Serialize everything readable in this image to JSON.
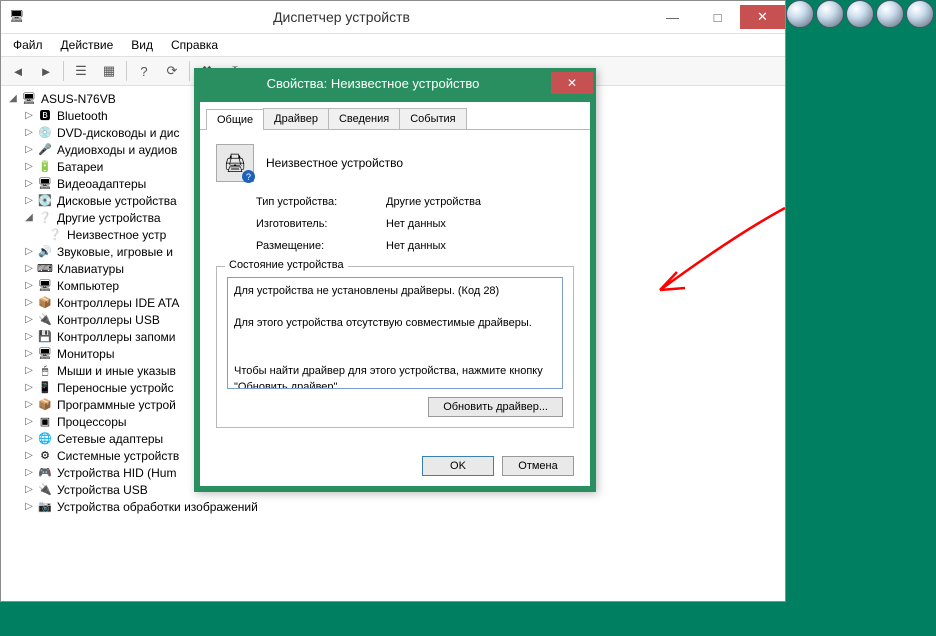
{
  "mainWindow": {
    "title": "Диспетчер устройств",
    "minimize": "—",
    "maximize": "□",
    "close": "✕"
  },
  "menu": {
    "file": "Файл",
    "action": "Действие",
    "view": "Вид",
    "help": "Справка"
  },
  "tree": {
    "root": "ASUS-N76VB",
    "items": [
      {
        "icon": "bt",
        "label": "Bluetooth",
        "exp": "▷"
      },
      {
        "icon": "dvd",
        "label": "DVD-дисководы и дис",
        "exp": "▷"
      },
      {
        "icon": "aud",
        "label": "Аудиовходы и аудиов",
        "exp": "▷"
      },
      {
        "icon": "bat",
        "label": "Батареи",
        "exp": "▷"
      },
      {
        "icon": "vid",
        "label": "Видеоадаптеры",
        "exp": "▷"
      },
      {
        "icon": "dsk",
        "label": "Дисковые устройства",
        "exp": "▷"
      },
      {
        "icon": "oth",
        "label": "Другие устройства",
        "exp": "◢",
        "child": "Неизвестное устр"
      },
      {
        "icon": "snd",
        "label": "Звуковые, игровые и",
        "exp": "▷"
      },
      {
        "icon": "kbd",
        "label": "Клавиатуры",
        "exp": "▷"
      },
      {
        "icon": "cmp",
        "label": "Компьютер",
        "exp": "▷"
      },
      {
        "icon": "ide",
        "label": "Контроллеры IDE ATA",
        "exp": "▷"
      },
      {
        "icon": "usb",
        "label": "Контроллеры USB",
        "exp": "▷"
      },
      {
        "icon": "stg",
        "label": "Контроллеры запоми",
        "exp": "▷"
      },
      {
        "icon": "mon",
        "label": "Мониторы",
        "exp": "▷"
      },
      {
        "icon": "mse",
        "label": "Мыши и иные указыв",
        "exp": "▷"
      },
      {
        "icon": "prt",
        "label": "Переносные устройс",
        "exp": "▷"
      },
      {
        "icon": "sft",
        "label": "Программные устрой",
        "exp": "▷"
      },
      {
        "icon": "cpu",
        "label": "Процессоры",
        "exp": "▷"
      },
      {
        "icon": "net",
        "label": "Сетевые адаптеры",
        "exp": "▷"
      },
      {
        "icon": "sys",
        "label": "Системные устройств",
        "exp": "▷"
      },
      {
        "icon": "hid",
        "label": "Устройства HID (Hum",
        "exp": "▷"
      },
      {
        "icon": "usb2",
        "label": "Устройства USB",
        "exp": "▷"
      },
      {
        "icon": "img",
        "label": "Устройства обработки изображений",
        "exp": "▷"
      }
    ]
  },
  "dialog": {
    "title": "Свойства: Неизвестное устройство",
    "tabs": {
      "general": "Общие",
      "driver": "Драйвер",
      "details": "Сведения",
      "events": "События"
    },
    "deviceName": "Неизвестное устройство",
    "rows": {
      "typeLabel": "Тип устройства:",
      "typeValue": "Другие устройства",
      "mfgLabel": "Изготовитель:",
      "mfgValue": "Нет данных",
      "locLabel": "Размещение:",
      "locValue": "Нет данных"
    },
    "statusTitle": "Состояние устройства",
    "statusText": "Для устройства не установлены драйверы. (Код 28)\n\nДля этого устройства отсутствую совместимые драйверы.\n\n\nЧтобы найти драйвер для этого устройства, нажмите кнопку \"Обновить драйвер\".",
    "updateBtn": "Обновить драйвер...",
    "ok": "OK",
    "cancel": "Отмена",
    "close": "✕"
  }
}
